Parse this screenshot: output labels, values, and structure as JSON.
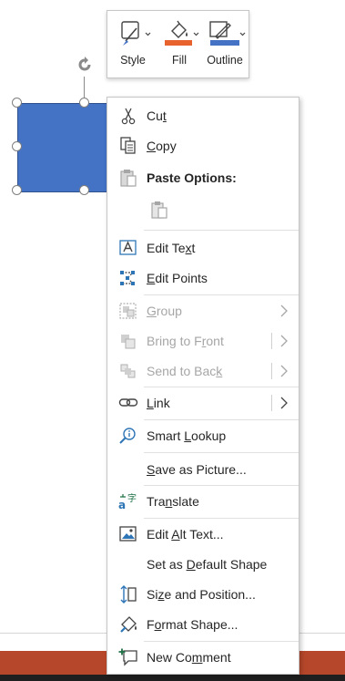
{
  "mini_toolbar": {
    "style_label": "Style",
    "fill_label": "Fill",
    "outline_label": "Outline",
    "fill_color": "#e8622d",
    "outline_color": "#4472c4"
  },
  "shape": {
    "fill_color": "#4472c4"
  },
  "menu": {
    "cut": {
      "pre": "Cu",
      "key": "t",
      "post": ""
    },
    "copy": {
      "pre": "",
      "key": "C",
      "post": "opy"
    },
    "paste_options": "Paste Options:",
    "edit_text": {
      "pre": "Edit Te",
      "key": "x",
      "post": "t"
    },
    "edit_points": {
      "pre": "",
      "key": "E",
      "post": "dit Points"
    },
    "group": {
      "pre": "",
      "key": "G",
      "post": "roup"
    },
    "bring_to_front": {
      "pre": "Bring to F",
      "key": "r",
      "post": "ont"
    },
    "send_to_back": {
      "pre": "Send to Bac",
      "key": "k",
      "post": ""
    },
    "link": {
      "pre": "",
      "key": "L",
      "post": "ink"
    },
    "smart_lookup": {
      "pre": "Smart ",
      "key": "L",
      "post": "ookup"
    },
    "save_as_picture": {
      "pre": "",
      "key": "S",
      "post": "ave as Picture..."
    },
    "translate": {
      "pre": "Tra",
      "key": "n",
      "post": "slate"
    },
    "edit_alt_text": {
      "pre": "Edit ",
      "key": "A",
      "post": "lt Text..."
    },
    "set_default_shape": {
      "pre": "Set as ",
      "key": "D",
      "post": "efault Shape"
    },
    "size_position": {
      "pre": "Si",
      "key": "z",
      "post": "e and Position..."
    },
    "format_shape": {
      "pre": "F",
      "key": "o",
      "post": "rmat Shape..."
    },
    "new_comment": {
      "pre": "New Co",
      "key": "m",
      "post": "ment"
    }
  },
  "app": {
    "status_bar_color": "#b7472a"
  }
}
